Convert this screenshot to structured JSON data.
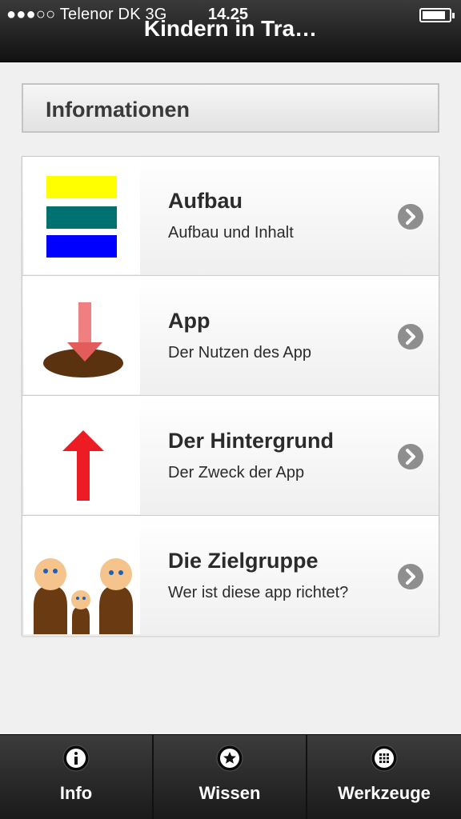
{
  "status_bar": {
    "carrier": "●●●○○ Telenor DK  3G",
    "time": "14.25"
  },
  "nav": {
    "title": "Kindern in Tra…"
  },
  "section": {
    "title": "Informationen"
  },
  "items": [
    {
      "title": "Aufbau",
      "subtitle": "Aufbau und Inhalt",
      "icon": "layers-icon"
    },
    {
      "title": "App",
      "subtitle": "Der Nutzen des App",
      "icon": "download-arrow-icon"
    },
    {
      "title": "Der Hintergrund",
      "subtitle": "Der Zweck der App",
      "icon": "up-arrow-icon"
    },
    {
      "title": "Die Zielgruppe",
      "subtitle": "Wer ist diese app richtet?",
      "icon": "family-icon"
    }
  ],
  "tabs": [
    {
      "label": "Info",
      "icon": "info-icon"
    },
    {
      "label": "Wissen",
      "icon": "star-icon"
    },
    {
      "label": "Werkzeuge",
      "icon": "grid-icon"
    }
  ],
  "colors": {
    "yellow": "#ffff00",
    "teal": "#007070",
    "blue": "#0000ff",
    "red": "#ed1c24",
    "brown": "#5a3210",
    "skin": "#f4c48c"
  }
}
